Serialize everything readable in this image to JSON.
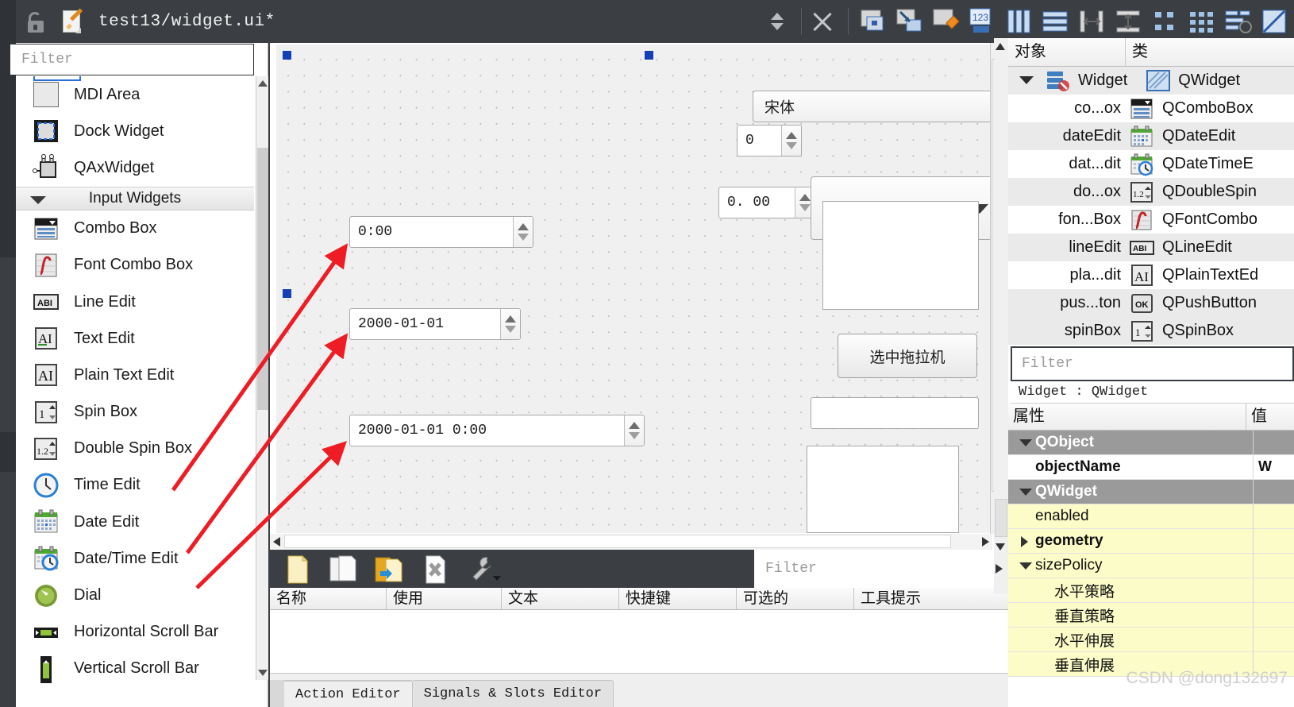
{
  "titlebar": {
    "filename": "test13/widget.ui*",
    "lock_icon": "unlock-icon",
    "file_icon": "edit-file-icon",
    "spin_icon": "updown-spinner-icon",
    "close_icon": "close-icon",
    "tools": [
      {
        "name": "edit-widgets-icon"
      },
      {
        "name": "edit-signals-slots-icon"
      },
      {
        "name": "edit-buddies-icon"
      },
      {
        "name": "edit-tab-order-icon"
      },
      {
        "name": "layout-horizontally-icon"
      },
      {
        "name": "layout-vertically-icon"
      },
      {
        "name": "layout-splitter-horizontal-icon"
      },
      {
        "name": "layout-splitter-vertical-icon"
      },
      {
        "name": "layout-form-icon"
      },
      {
        "name": "layout-grid-icon"
      },
      {
        "name": "break-layout-icon"
      },
      {
        "name": "adjust-size-icon"
      }
    ]
  },
  "widgetbox": {
    "filter_placeholder": "Filter",
    "items": [
      {
        "label": "MDI Area",
        "icon": "mdi-area-icon",
        "type": "item"
      },
      {
        "label": "Dock Widget",
        "icon": "dock-widget-icon",
        "type": "item"
      },
      {
        "label": "QAxWidget",
        "icon": "qaxwidget-icon",
        "type": "item"
      },
      {
        "label": "Input Widgets",
        "icon": "chevron-down-icon",
        "type": "group"
      },
      {
        "label": "Combo Box",
        "icon": "combo-box-icon",
        "type": "item"
      },
      {
        "label": "Font Combo Box",
        "icon": "font-combo-box-icon",
        "type": "item"
      },
      {
        "label": "Line Edit",
        "icon": "line-edit-icon",
        "type": "item"
      },
      {
        "label": "Text Edit",
        "icon": "text-edit-icon",
        "type": "item"
      },
      {
        "label": "Plain Text Edit",
        "icon": "plain-text-edit-icon",
        "type": "item"
      },
      {
        "label": "Spin Box",
        "icon": "spin-box-icon",
        "type": "item"
      },
      {
        "label": "Double Spin Box",
        "icon": "double-spin-box-icon",
        "type": "item"
      },
      {
        "label": "Time Edit",
        "icon": "time-edit-icon",
        "type": "item"
      },
      {
        "label": "Date Edit",
        "icon": "date-edit-icon",
        "type": "item"
      },
      {
        "label": "Date/Time Edit",
        "icon": "date-time-edit-icon",
        "type": "item"
      },
      {
        "label": "Dial",
        "icon": "dial-icon",
        "type": "item"
      },
      {
        "label": "Horizontal Scroll Bar",
        "icon": "horizontal-scroll-bar-icon",
        "type": "item"
      },
      {
        "label": "Vertical Scroll Bar",
        "icon": "vertical-scroll-bar-icon",
        "type": "item"
      }
    ]
  },
  "canvas": {
    "font_combo_value": "宋体",
    "spinbox_value": "0",
    "double_spinbox_value": "0. 00",
    "combo_value": "",
    "time_edit_value": "0:00",
    "date_edit_value": "2000-01-01",
    "datetime_edit_value": "2000-01-01 0:00",
    "push_button_label": "选中拖拉机",
    "line_edit_value": "",
    "plain_text_edit_value": ""
  },
  "action_editor": {
    "filter_placeholder": "Filter",
    "toolbar": [
      {
        "name": "new-action-icon"
      },
      {
        "name": "copy-action-icon"
      },
      {
        "name": "paste-action-icon"
      },
      {
        "name": "delete-action-icon"
      },
      {
        "name": "configure-icon"
      }
    ],
    "columns": [
      "名称",
      "使用",
      "文本",
      "快捷键",
      "可选的",
      "工具提示"
    ],
    "rows": [],
    "tabs": [
      {
        "label": "Action Editor",
        "selected": true
      },
      {
        "label": "Signals & Slots Editor",
        "selected": false
      }
    ]
  },
  "object_inspector": {
    "columns": [
      "对象",
      "类"
    ],
    "rows": [
      {
        "name": "Widget",
        "class": "QWidget",
        "icon": "widget-icon",
        "indent": 0,
        "expanded": true
      },
      {
        "name": "co...ox",
        "class": "QComboBox",
        "icon": "combo-box-icon",
        "indent": 1
      },
      {
        "name": "dateEdit",
        "class": "QDateEdit",
        "icon": "date-edit-icon",
        "indent": 1
      },
      {
        "name": "dat...dit",
        "class": "QDateTimeE",
        "icon": "date-time-edit-icon",
        "indent": 1
      },
      {
        "name": "do...ox",
        "class": "QDoubleSpin",
        "icon": "double-spin-box-icon",
        "indent": 1
      },
      {
        "name": "fon...Box",
        "class": "QFontCombo",
        "icon": "font-combo-box-icon",
        "indent": 1
      },
      {
        "name": "lineEdit",
        "class": "QLineEdit",
        "icon": "line-edit-icon",
        "indent": 1
      },
      {
        "name": "pla...dit",
        "class": "QPlainTextEd",
        "icon": "plain-text-edit-icon",
        "indent": 1
      },
      {
        "name": "pus...ton",
        "class": "QPushButton",
        "icon": "push-button-icon",
        "indent": 1
      },
      {
        "name": "spinBox",
        "class": "QSpinBox",
        "icon": "spin-box-icon",
        "indent": 1
      }
    ]
  },
  "property_editor": {
    "filter_placeholder": "Filter",
    "target": "Widget : QWidget",
    "columns": [
      "属性",
      "值"
    ],
    "rows": [
      {
        "label": "QObject",
        "kind": "group",
        "expanded": true
      },
      {
        "label": "objectName",
        "kind": "prop-bold",
        "value": "W"
      },
      {
        "label": "QWidget",
        "kind": "group",
        "expanded": true
      },
      {
        "label": "enabled",
        "kind": "prop",
        "value": ""
      },
      {
        "label": "geometry",
        "kind": "prop-bold-collapsed",
        "value": ""
      },
      {
        "label": "sizePolicy",
        "kind": "prop-expanded",
        "value": ""
      },
      {
        "label": "水平策略",
        "kind": "subprop",
        "value": ""
      },
      {
        "label": "垂直策略",
        "kind": "subprop",
        "value": ""
      },
      {
        "label": "水平伸展",
        "kind": "subprop",
        "value": ""
      },
      {
        "label": "垂直伸展",
        "kind": "subprop",
        "value": ""
      }
    ]
  },
  "watermark": "CSDN @dong132697",
  "colors": {
    "chrome": "#3b3f44",
    "accent_blue": "#153fb5",
    "arrow_red": "#ee1c24",
    "yellow_row": "#fcfcc8",
    "group_row": "#9a9a9a"
  }
}
